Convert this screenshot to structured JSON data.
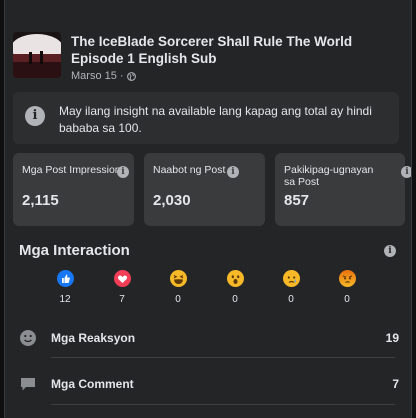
{
  "post": {
    "title": "The IceBlade Sorcerer Shall Rule The World Episode 1 English Sub",
    "date": "Marso 15",
    "separator": "·"
  },
  "notice": {
    "text": "May ilang insight na available lang kapag ang total ay hindi bababa sa 100."
  },
  "stats": [
    {
      "label": "Mga Post Impression",
      "value": "2,115"
    },
    {
      "label": "Naabot ng Post",
      "value": "2,030"
    },
    {
      "label": "Pakikipag-ugnayan sa Post",
      "value": "857"
    }
  ],
  "interactions": {
    "title": "Mga Interaction",
    "reactions": [
      {
        "name": "like",
        "count": "12"
      },
      {
        "name": "love",
        "count": "7"
      },
      {
        "name": "haha",
        "count": "0"
      },
      {
        "name": "wow",
        "count": "0"
      },
      {
        "name": "sad",
        "count": "0"
      },
      {
        "name": "angry",
        "count": "0"
      }
    ]
  },
  "breakdown": [
    {
      "label": "Mga Reaksyon",
      "value": "19"
    },
    {
      "label": "Mga Comment",
      "value": "7"
    }
  ],
  "colors": {
    "like": "#1877f2",
    "love": "#f33e58",
    "emoji_yellow": "#f7b928",
    "angry": "#e9710f"
  }
}
